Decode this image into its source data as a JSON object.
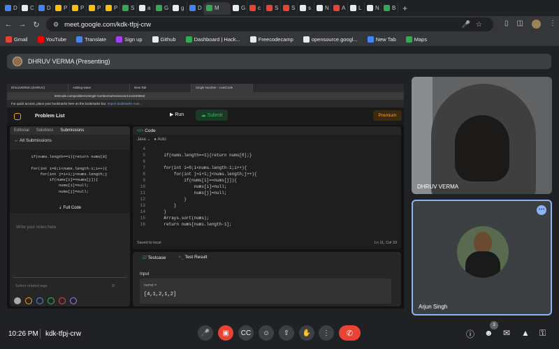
{
  "browser": {
    "tabs": [
      {
        "label": "D",
        "color": "#4285f4"
      },
      {
        "label": "C",
        "color": "#e8eaed"
      },
      {
        "label": "D",
        "color": "#4285f4"
      },
      {
        "label": "P",
        "color": "#fbbc04"
      },
      {
        "label": "P",
        "color": "#fbbc04"
      },
      {
        "label": "P",
        "color": "#fbbc04"
      },
      {
        "label": "P",
        "color": "#fbbc04"
      },
      {
        "label": "S",
        "color": "#34a853"
      },
      {
        "label": "a",
        "color": "#e8eaed"
      },
      {
        "label": "G",
        "color": "#34a853"
      },
      {
        "label": "g",
        "color": "#e8eaed"
      },
      {
        "label": "D",
        "color": "#4285f4"
      },
      {
        "label": "M",
        "color": "#34a853"
      },
      {
        "label": "G",
        "color": "#e8eaed"
      },
      {
        "label": "c",
        "color": "#ea4335"
      },
      {
        "label": "S",
        "color": "#ea4335"
      },
      {
        "label": "S",
        "color": "#ea4335"
      },
      {
        "label": "s",
        "color": "#e8eaed"
      },
      {
        "label": "N",
        "color": "#e8eaed"
      },
      {
        "label": "A",
        "color": "#ea4335"
      },
      {
        "label": "L",
        "color": "#e8eaed"
      },
      {
        "label": "N",
        "color": "#e8eaed"
      },
      {
        "label": "B",
        "color": "#34a853"
      }
    ],
    "url": "meet.google.com/kdk-tfpj-crw",
    "bookmarks": [
      {
        "label": "Gmail",
        "color": "#ea4335"
      },
      {
        "label": "YouTube",
        "color": "#ff0000"
      },
      {
        "label": "Translate",
        "color": "#4285f4"
      },
      {
        "label": "Sign up",
        "color": "#a142f4"
      },
      {
        "label": "Github",
        "color": "#e8eaed"
      },
      {
        "label": "Dashboard | Hack...",
        "color": "#34a853"
      },
      {
        "label": "Freecodecamp",
        "color": "#e8eaed"
      },
      {
        "label": "opensource.googl...",
        "color": "#e8eaed"
      },
      {
        "label": "New Tab",
        "color": "#4285f4"
      },
      {
        "label": "Maps",
        "color": "#34a853"
      }
    ]
  },
  "meet": {
    "presenter_bar": "DHRUV VERMA (Presenting)",
    "shared": {
      "tabs": [
        "DhruvVERMA (DHRUV)",
        "Adding-wave",
        "New Tab",
        "Single Number - LeetCode"
      ],
      "url": "leetcode.com/problems/single-number/submissions/1141633694/",
      "notice": "For quick access, place your bookmarks here on the bookmarks bar.",
      "notice_link": "Import bookmarks now...",
      "problem_list": "Problem List",
      "run": "Run",
      "submit": "Submit",
      "premium": "Premium",
      "left_tabs": [
        "Editorial",
        "Solutions",
        "Submissions"
      ],
      "all_submissions": "All Submissions",
      "left_code": "        if(nums.length==1){return nums[0]\n\n        for(int i=0;i<nums.length-1;i++){\n            for(int j=i+1;j<nums.length;j\n                if(nums[i]==nums[j]){\n                    nums[i]=null;\n                    nums[j]=null;",
      "full_code": "Full Code",
      "notes_placeholder": "Write your notes here",
      "tags_placeholder": "Select related tags",
      "tags_count": "0/",
      "code_title": "Code",
      "lang": "Java",
      "auto": "Auto",
      "code_lines": [
        {
          "n": "4",
          "t": ""
        },
        {
          "n": "5",
          "t": "    if(nums.length==1){return nums[0];}"
        },
        {
          "n": "6",
          "t": ""
        },
        {
          "n": "7",
          "t": "    for(int i=0;i<nums.length-1;i++){"
        },
        {
          "n": "8",
          "t": "        for(int j=i+1;j<nums.length;j++){"
        },
        {
          "n": "9",
          "t": "            if(nums[i]==nums[j]){"
        },
        {
          "n": "10",
          "t": "                nums[i]=null;"
        },
        {
          "n": "11",
          "t": "                nums[j]=null;"
        },
        {
          "n": "12",
          "t": "            }"
        },
        {
          "n": "13",
          "t": "        }"
        },
        {
          "n": "14",
          "t": "    }"
        },
        {
          "n": "15",
          "t": "    Arrays.sort(nums);"
        },
        {
          "n": "16",
          "t": "    return nums[nums.length-1];"
        }
      ],
      "saved": "Saved to local",
      "cursor_pos": "Ln 11, Col 33",
      "testcase": "Testcase",
      "test_result": "Test Result",
      "input_label": "Input",
      "nums_label": "nums =",
      "nums_value": "[4,1,2,1,2]"
    },
    "participants": [
      {
        "name": "DHRUV VERMA"
      },
      {
        "name": "Arjun Singh"
      }
    ],
    "time": "10:26 PM",
    "meeting_code": "kdk-tfpj-crw",
    "participant_count": "3",
    "accent": "#8ab4f8",
    "end_color": "#ea4335"
  }
}
